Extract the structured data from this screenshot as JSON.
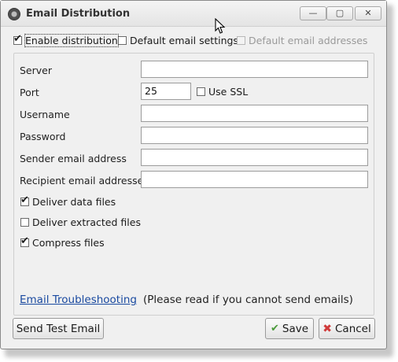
{
  "window": {
    "title": "Email Distribution",
    "min_label": "—",
    "max_label": "▢",
    "close_label": "✕"
  },
  "options": {
    "enable_distribution": {
      "label": "Enable distribution",
      "checked": true
    },
    "default_email_settings": {
      "label": "Default email settings",
      "checked": false
    },
    "default_email_addresses": {
      "label": "Default email addresses",
      "checked": false,
      "disabled": true
    }
  },
  "form": {
    "server": {
      "label": "Server",
      "value": ""
    },
    "port": {
      "label": "Port",
      "value": "25"
    },
    "use_ssl": {
      "label": "Use SSL",
      "checked": false
    },
    "username": {
      "label": "Username",
      "value": ""
    },
    "password": {
      "label": "Password",
      "value": ""
    },
    "sender": {
      "label": "Sender email address",
      "value": ""
    },
    "recipient": {
      "label": "Recipient email addresses",
      "value": ""
    },
    "deliver_data": {
      "label": "Deliver data files",
      "checked": true
    },
    "deliver_extracted": {
      "label": "Deliver extracted files",
      "checked": false
    },
    "compress": {
      "label": "Compress files",
      "checked": true
    }
  },
  "help": {
    "link": "Email Troubleshooting",
    "note": "(Please read if you cannot send emails)"
  },
  "buttons": {
    "send_test": "Send Test Email",
    "save": "Save",
    "cancel": "Cancel"
  }
}
